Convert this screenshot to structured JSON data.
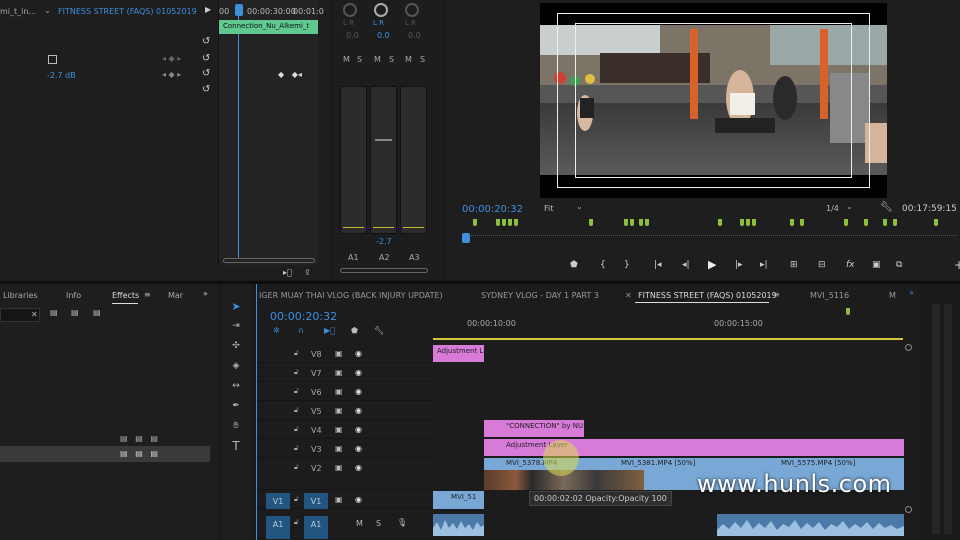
{
  "source_panel": {
    "tab_clip": "mi_t_in...",
    "tab_seq": "FITNESS STREET (FAQS) 01052019",
    "tc_a": "00",
    "tc_b": "00:00:30:00",
    "tc_c": "00:01:0",
    "clip_label": "Connection_Nu_Alkemi_t",
    "level_value": "-2.7 dB"
  },
  "audio_mixer": {
    "channels": [
      {
        "name": "A1",
        "value": "0.0",
        "db": ""
      },
      {
        "name": "A2",
        "value": "0.0",
        "db": "-2.7"
      },
      {
        "name": "A3",
        "value": "0.0",
        "db": ""
      }
    ],
    "buttons": [
      "M",
      "S",
      "M",
      "S",
      "M",
      "S"
    ]
  },
  "program_monitor": {
    "timecode": "00:00:20:32",
    "fit": "Fit",
    "resolution": "1/4",
    "duration": "00:17:59:15"
  },
  "effects_panel": {
    "tabs": [
      "Libraries",
      "Info",
      "Effects",
      "Mar"
    ]
  },
  "timeline": {
    "tabs": [
      "IGER MUAY THAI VLOG (BACK INJURY UPDATE)",
      "SYDNEY VLOG - DAY 1 PART 3",
      "FITNESS STREET (FAQS) 01052019",
      "MVI_5116",
      "M"
    ],
    "timecode": "00:00:20:32",
    "ruler": [
      "00:00:10:00",
      "00:00:15:00"
    ],
    "tracks": [
      "V8",
      "V7",
      "V6",
      "V5",
      "V4",
      "V3",
      "V2",
      "V1",
      "A1"
    ],
    "source_v1": "V1",
    "source_a1": "A1",
    "clips": {
      "v8_adjust": "Adjustment Layer",
      "v4_title": "\"CONNECTION\" by NU A",
      "v3_adjust": "Adjustment Layer",
      "v2_a": "MVI_5378.MP4",
      "v2_b": "MVI_5381.MP4 [50%]",
      "v2_c": "MVI_5575.MP4 [50%]",
      "v1_a": "MVI_51",
      "tooltip": "00:00:02:02   Opacity:Opacity  100"
    },
    "track_buttons": {
      "m": "M",
      "s": "S"
    }
  },
  "watermark": "www.hunls.com",
  "colors": {
    "accent": "#3d8fe0",
    "clip_pink": "#d87ad8",
    "clip_cyan": "#79a8d6",
    "clip_green": "#5fc98f",
    "marker": "#8cbf3f"
  }
}
